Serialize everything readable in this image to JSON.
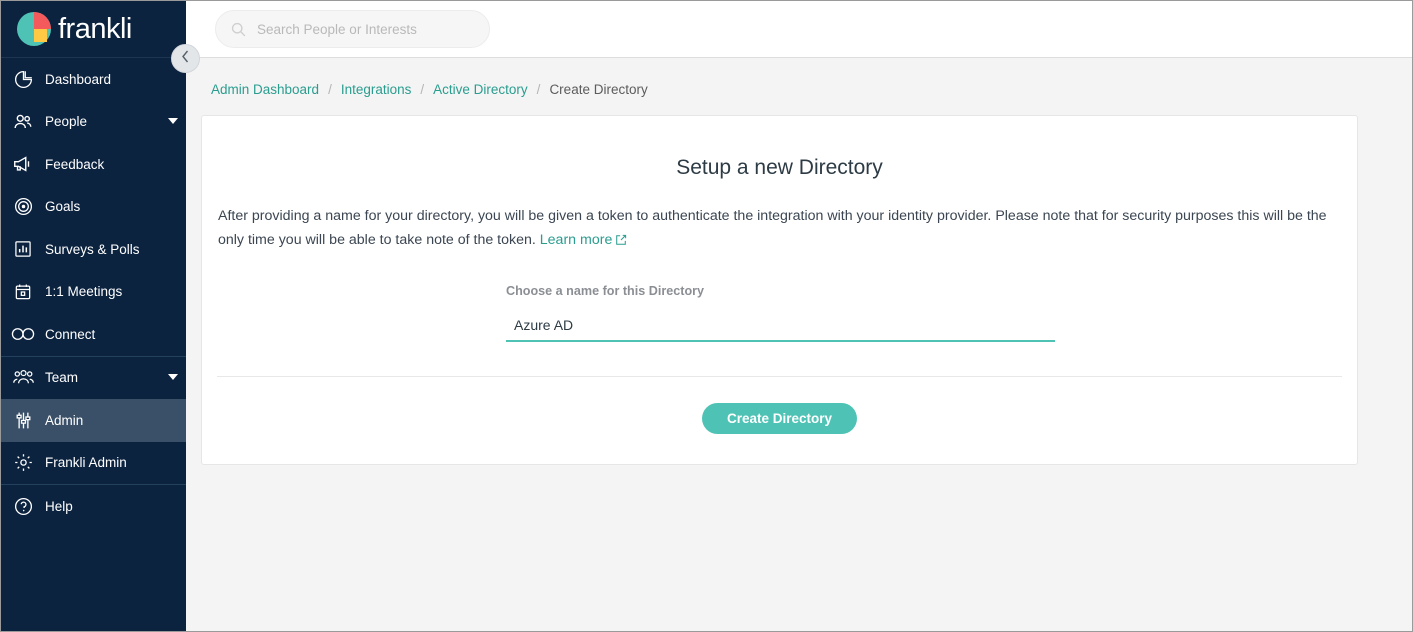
{
  "brand": {
    "name": "frankli",
    "logo_icon": "franklin-pie-logo-icon",
    "colors": {
      "teal": "#4ec3b5",
      "red": "#f4595b",
      "yellow": "#ffc845",
      "navy": "#0c2340"
    }
  },
  "sidebar": {
    "collapse_icon": "chevron-left-icon",
    "items": [
      {
        "label": "Dashboard",
        "icon": "pie-chart-icon",
        "active": false,
        "caret": false
      },
      {
        "label": "People",
        "icon": "people-icon",
        "active": false,
        "caret": true
      },
      {
        "label": "Feedback",
        "icon": "megaphone-icon",
        "active": false,
        "caret": false
      },
      {
        "label": "Goals",
        "icon": "target-icon",
        "active": false,
        "caret": false
      },
      {
        "label": "Surveys & Polls",
        "icon": "bar-chart-icon",
        "active": false,
        "caret": false
      },
      {
        "label": "1:1 Meetings",
        "icon": "calendar-icon",
        "active": false,
        "caret": false
      },
      {
        "label": "Connect",
        "icon": "infinity-icon",
        "active": false,
        "caret": false
      },
      {
        "label": "Team",
        "icon": "team-group-icon",
        "active": false,
        "caret": true
      },
      {
        "label": "Admin",
        "icon": "sliders-icon",
        "active": true,
        "caret": false
      },
      {
        "label": "Frankli Admin",
        "icon": "gear-icon",
        "active": false,
        "caret": false
      },
      {
        "label": "Help",
        "icon": "question-circle-icon",
        "active": false,
        "caret": false
      }
    ]
  },
  "topbar": {
    "search": {
      "placeholder": "Search People or Interests",
      "value": "",
      "icon": "search-icon"
    }
  },
  "breadcrumb": {
    "items": [
      {
        "label": "Admin Dashboard",
        "current": false
      },
      {
        "label": "Integrations",
        "current": false
      },
      {
        "label": "Active Directory",
        "current": false
      },
      {
        "label": "Create Directory",
        "current": true
      }
    ],
    "separator": "/"
  },
  "main": {
    "title": "Setup a new Directory",
    "description_part1": "After providing a name for your directory, you will be given a token to authenticate the integration with your identity provider. Please note that for security purposes this will be the only time you will be able to take note of the token. ",
    "learn_more_label": "Learn more",
    "learn_more_icon": "external-link-icon",
    "field": {
      "label": "Choose a name for this Directory",
      "value": "Azure AD",
      "placeholder": ""
    },
    "submit_label": "Create Directory"
  }
}
